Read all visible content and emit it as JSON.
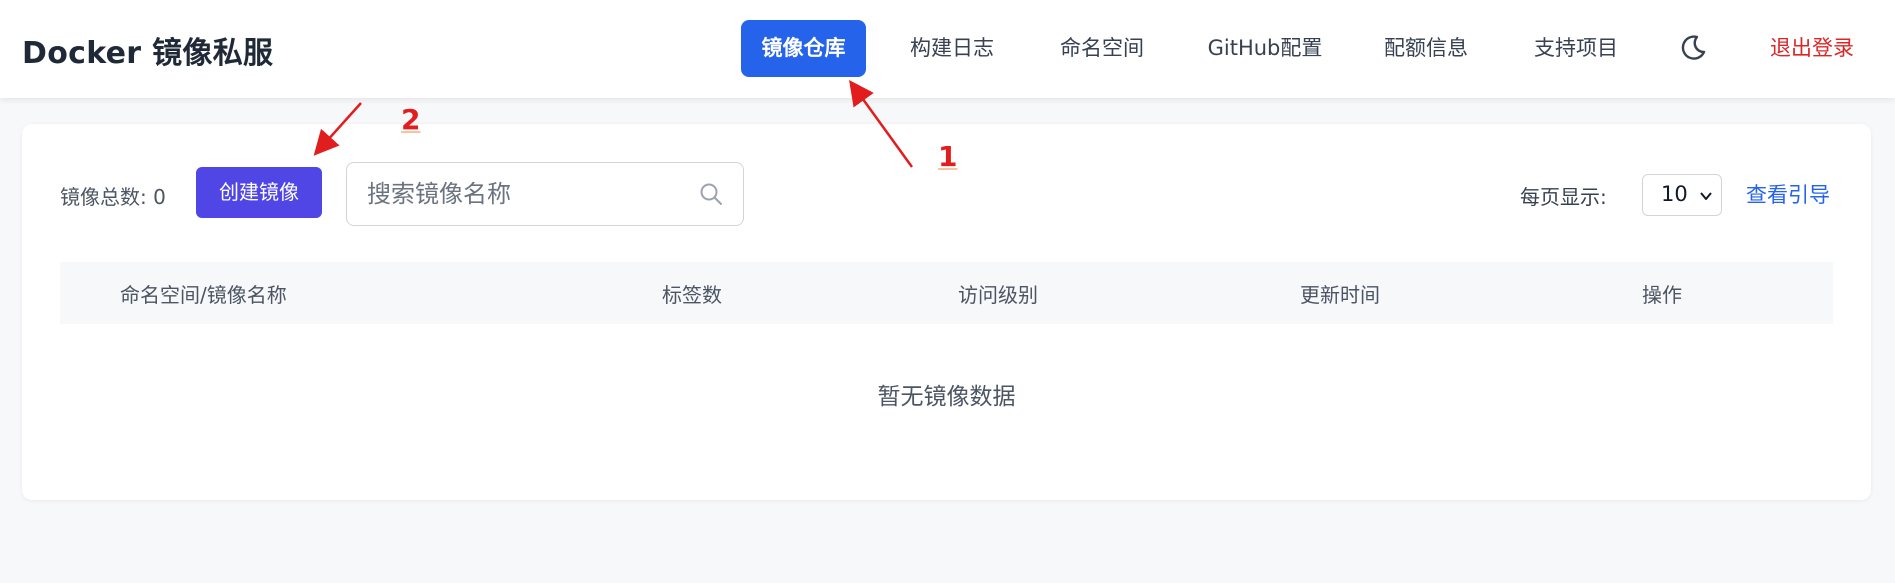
{
  "brand": {
    "title": "Docker 镜像私服"
  },
  "nav": {
    "items": [
      {
        "label": "镜像仓库",
        "active": true
      },
      {
        "label": "构建日志"
      },
      {
        "label": "命名空间"
      },
      {
        "label": "GitHub配置"
      },
      {
        "label": "配额信息"
      },
      {
        "label": "支持项目"
      }
    ],
    "theme_icon": "moon-icon",
    "logout_label": "退出登录"
  },
  "toolbar": {
    "count_label": "镜像总数: 0",
    "create_label": "创建镜像",
    "search_placeholder": "搜索镜像名称",
    "search_icon": "search-icon",
    "per_page_label": "每页显示:",
    "per_page_value": "10",
    "guide_label": "查看引导"
  },
  "table": {
    "columns": [
      "命名空间/镜像名称",
      "标签数",
      "访问级别",
      "更新时间",
      "操作"
    ],
    "empty_text": "暂无镜像数据"
  },
  "annotations": {
    "markers": [
      "1",
      "2"
    ],
    "color": "#e11d1d"
  },
  "colors": {
    "primary": "#2563eb",
    "create_button": "#4f46e5",
    "logout": "#dc2626"
  }
}
